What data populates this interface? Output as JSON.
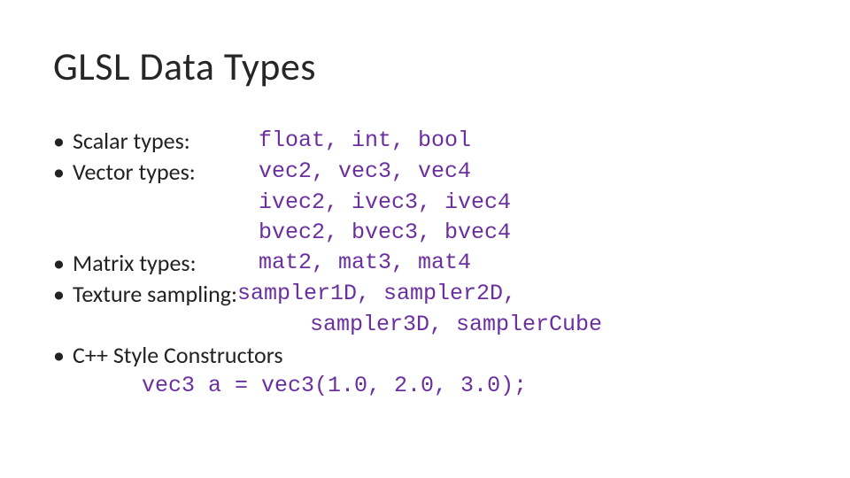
{
  "title": "GLSL Data Types",
  "bullets": {
    "scalar": {
      "label": "Scalar types:",
      "code": "float, int, bool"
    },
    "vector": {
      "label": "Vector types:",
      "code1": "vec2, vec3, vec4",
      "code2": "ivec2, ivec3, ivec4",
      "code3": "bvec2, bvec3, bvec4"
    },
    "matrix": {
      "label": "Matrix types:",
      "code": "mat2, mat3, mat4"
    },
    "texture": {
      "label": "Texture sampling: ",
      "code1": "sampler1D, sampler2D,",
      "code2": "sampler3D, samplerCube"
    },
    "ctor": {
      "label": "C++ Style Constructors",
      "code": "vec3 a = vec3(1.0, 2.0, 3.0);"
    }
  }
}
